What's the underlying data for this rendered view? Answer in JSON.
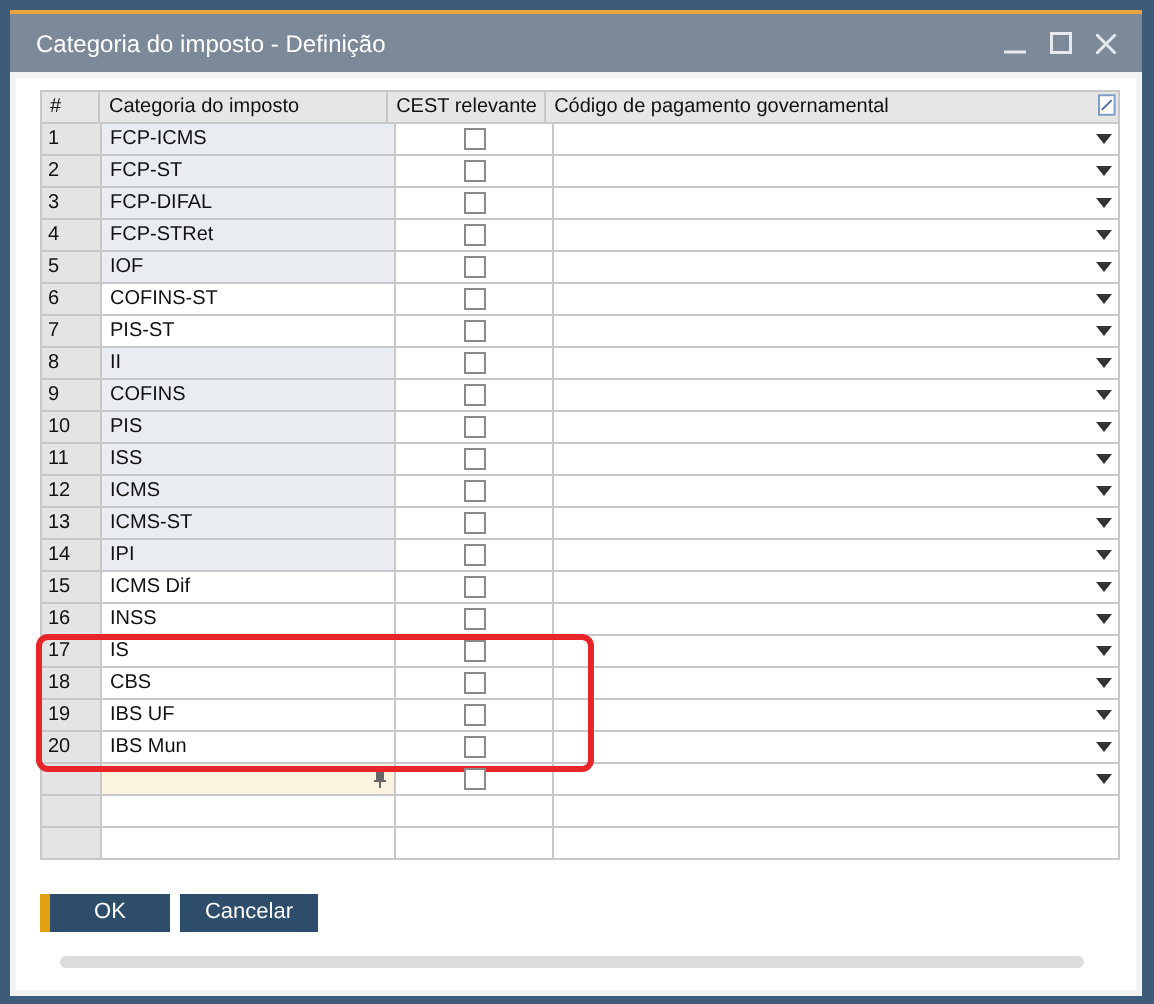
{
  "window": {
    "title": "Categoria do imposto - Definição"
  },
  "table": {
    "columns": [
      "#",
      "Categoria do imposto",
      "CEST relevante",
      "Código de pagamento governamental"
    ],
    "rows": [
      {
        "kind": "entry",
        "number": "1",
        "category": "FCP-ICMS",
        "locked": true,
        "cest_checked": false,
        "highlighted": false
      },
      {
        "kind": "entry",
        "number": "2",
        "category": "FCP-ST",
        "locked": true,
        "cest_checked": false,
        "highlighted": false
      },
      {
        "kind": "entry",
        "number": "3",
        "category": "FCP-DIFAL",
        "locked": true,
        "cest_checked": false,
        "highlighted": false
      },
      {
        "kind": "entry",
        "number": "4",
        "category": "FCP-STRet",
        "locked": true,
        "cest_checked": false,
        "highlighted": false
      },
      {
        "kind": "entry",
        "number": "5",
        "category": "IOF",
        "locked": true,
        "cest_checked": false,
        "highlighted": false
      },
      {
        "kind": "entry",
        "number": "6",
        "category": "COFINS-ST",
        "locked": false,
        "cest_checked": false,
        "highlighted": false
      },
      {
        "kind": "entry",
        "number": "7",
        "category": "PIS-ST",
        "locked": false,
        "cest_checked": false,
        "highlighted": false
      },
      {
        "kind": "entry",
        "number": "8",
        "category": "II",
        "locked": true,
        "cest_checked": false,
        "highlighted": false
      },
      {
        "kind": "entry",
        "number": "9",
        "category": "COFINS",
        "locked": true,
        "cest_checked": false,
        "highlighted": false
      },
      {
        "kind": "entry",
        "number": "10",
        "category": "PIS",
        "locked": true,
        "cest_checked": false,
        "highlighted": false
      },
      {
        "kind": "entry",
        "number": "11",
        "category": "ISS",
        "locked": true,
        "cest_checked": false,
        "highlighted": false
      },
      {
        "kind": "entry",
        "number": "12",
        "category": "ICMS",
        "locked": true,
        "cest_checked": false,
        "highlighted": false
      },
      {
        "kind": "entry",
        "number": "13",
        "category": "ICMS-ST",
        "locked": true,
        "cest_checked": false,
        "highlighted": false
      },
      {
        "kind": "entry",
        "number": "14",
        "category": "IPI",
        "locked": true,
        "cest_checked": false,
        "highlighted": false
      },
      {
        "kind": "entry",
        "number": "15",
        "category": "ICMS Dif",
        "locked": false,
        "cest_checked": false,
        "highlighted": false
      },
      {
        "kind": "entry",
        "number": "16",
        "category": "INSS",
        "locked": false,
        "cest_checked": false,
        "highlighted": false
      },
      {
        "kind": "entry",
        "number": "17",
        "category": "IS",
        "locked": false,
        "cest_checked": false,
        "highlighted": true
      },
      {
        "kind": "entry",
        "number": "18",
        "category": "CBS",
        "locked": false,
        "cest_checked": false,
        "highlighted": true
      },
      {
        "kind": "entry",
        "number": "19",
        "category": "IBS UF",
        "locked": false,
        "cest_checked": false,
        "highlighted": true
      },
      {
        "kind": "entry",
        "number": "20",
        "category": "IBS Mun",
        "locked": false,
        "cest_checked": false,
        "highlighted": true
      },
      {
        "kind": "new",
        "cest_checked": false
      },
      {
        "kind": "empty"
      },
      {
        "kind": "empty"
      }
    ]
  },
  "buttons": [
    {
      "label": "OK",
      "default": true
    },
    {
      "label": "Cancelar",
      "default": false
    }
  ]
}
